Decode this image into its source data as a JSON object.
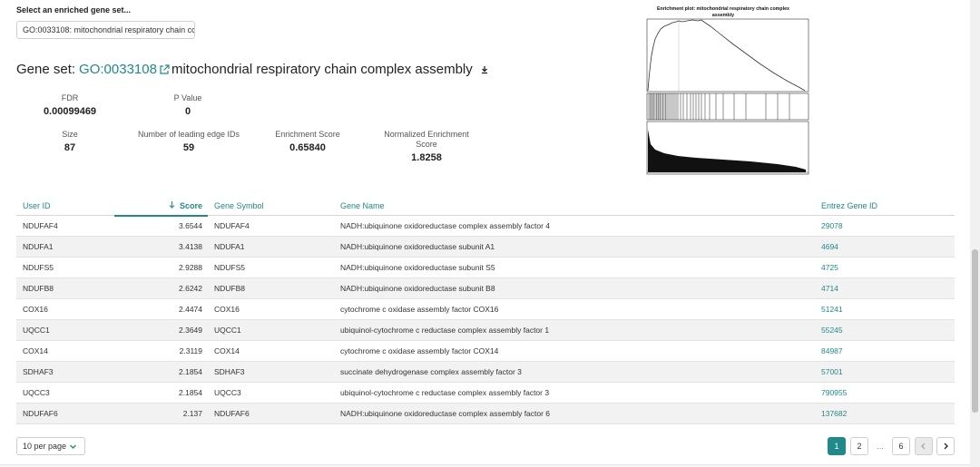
{
  "selector": {
    "label": "Select an enriched gene set...",
    "value": "GO:0033108: mitochondrial respiratory chain co"
  },
  "gene_set": {
    "prefix": "Gene set: ",
    "id": "GO:0033108",
    "name": "mitochondrial respiratory chain complex assembly"
  },
  "stats": {
    "fdr_label": "FDR",
    "fdr_value": "0.00099469",
    "pvalue_label": "P Value",
    "pvalue_value": "0",
    "size_label": "Size",
    "size_value": "87",
    "leading_label": "Number of leading edge IDs",
    "leading_value": "59",
    "es_label": "Enrichment Score",
    "es_value": "0.65840",
    "nes_label": "Normalized Enrichment Score",
    "nes_value": "1.8258"
  },
  "plot": {
    "title_line1": "Enrichment plot: mitochondrial respiratory chain complex",
    "title_line2": "assembly"
  },
  "table": {
    "headers": {
      "user_id": "User ID",
      "score": "Score",
      "gene_symbol": "Gene Symbol",
      "gene_name": "Gene Name",
      "entrez": "Entrez Gene ID"
    },
    "rows": [
      {
        "user_id": "NDUFAF4",
        "score": "3.6544",
        "symbol": "NDUFAF4",
        "name": "NADH:ubiquinone oxidoreductase complex assembly factor 4",
        "entrez": "29078"
      },
      {
        "user_id": "NDUFA1",
        "score": "3.4138",
        "symbol": "NDUFA1",
        "name": "NADH:ubiquinone oxidoreductase subunit A1",
        "entrez": "4694"
      },
      {
        "user_id": "NDUFS5",
        "score": "2.9288",
        "symbol": "NDUFS5",
        "name": "NADH:ubiquinone oxidoreductase subunit S5",
        "entrez": "4725"
      },
      {
        "user_id": "NDUFB8",
        "score": "2.6242",
        "symbol": "NDUFB8",
        "name": "NADH:ubiquinone oxidoreductase subunit B8",
        "entrez": "4714"
      },
      {
        "user_id": "COX16",
        "score": "2.4474",
        "symbol": "COX16",
        "name": "cytochrome c oxidase assembly factor COX16",
        "entrez": "51241"
      },
      {
        "user_id": "UQCC1",
        "score": "2.3649",
        "symbol": "UQCC1",
        "name": "ubiquinol-cytochrome c reductase complex assembly factor 1",
        "entrez": "55245"
      },
      {
        "user_id": "COX14",
        "score": "2.3119",
        "symbol": "COX14",
        "name": "cytochrome c oxidase assembly factor COX14",
        "entrez": "84987"
      },
      {
        "user_id": "SDHAF3",
        "score": "2.1854",
        "symbol": "SDHAF3",
        "name": "succinate dehydrogenase complex assembly factor 3",
        "entrez": "57001"
      },
      {
        "user_id": "UQCC3",
        "score": "2.1854",
        "symbol": "UQCC3",
        "name": "ubiquinol-cytochrome c reductase complex assembly factor 3",
        "entrez": "790955"
      },
      {
        "user_id": "NDUFAF6",
        "score": "2.137",
        "symbol": "NDUFAF6",
        "name": "NADH:ubiquinone oxidoreductase complex assembly factor 6",
        "entrez": "137682"
      }
    ]
  },
  "pagination": {
    "per_page": "10 per page",
    "pages": [
      "1",
      "2",
      "...",
      "6"
    ],
    "current": "1",
    "prev_icon": "chevron-left-icon",
    "next_icon": "chevron-right-icon"
  },
  "icons": {
    "external_link": "external-link-icon",
    "download": "download-icon",
    "sort": "sort-down-arrow-icon",
    "dropdown": "chevron-down-icon"
  },
  "colors": {
    "accent": "#1f8a8a",
    "row_alt": "#f2f2f2"
  }
}
